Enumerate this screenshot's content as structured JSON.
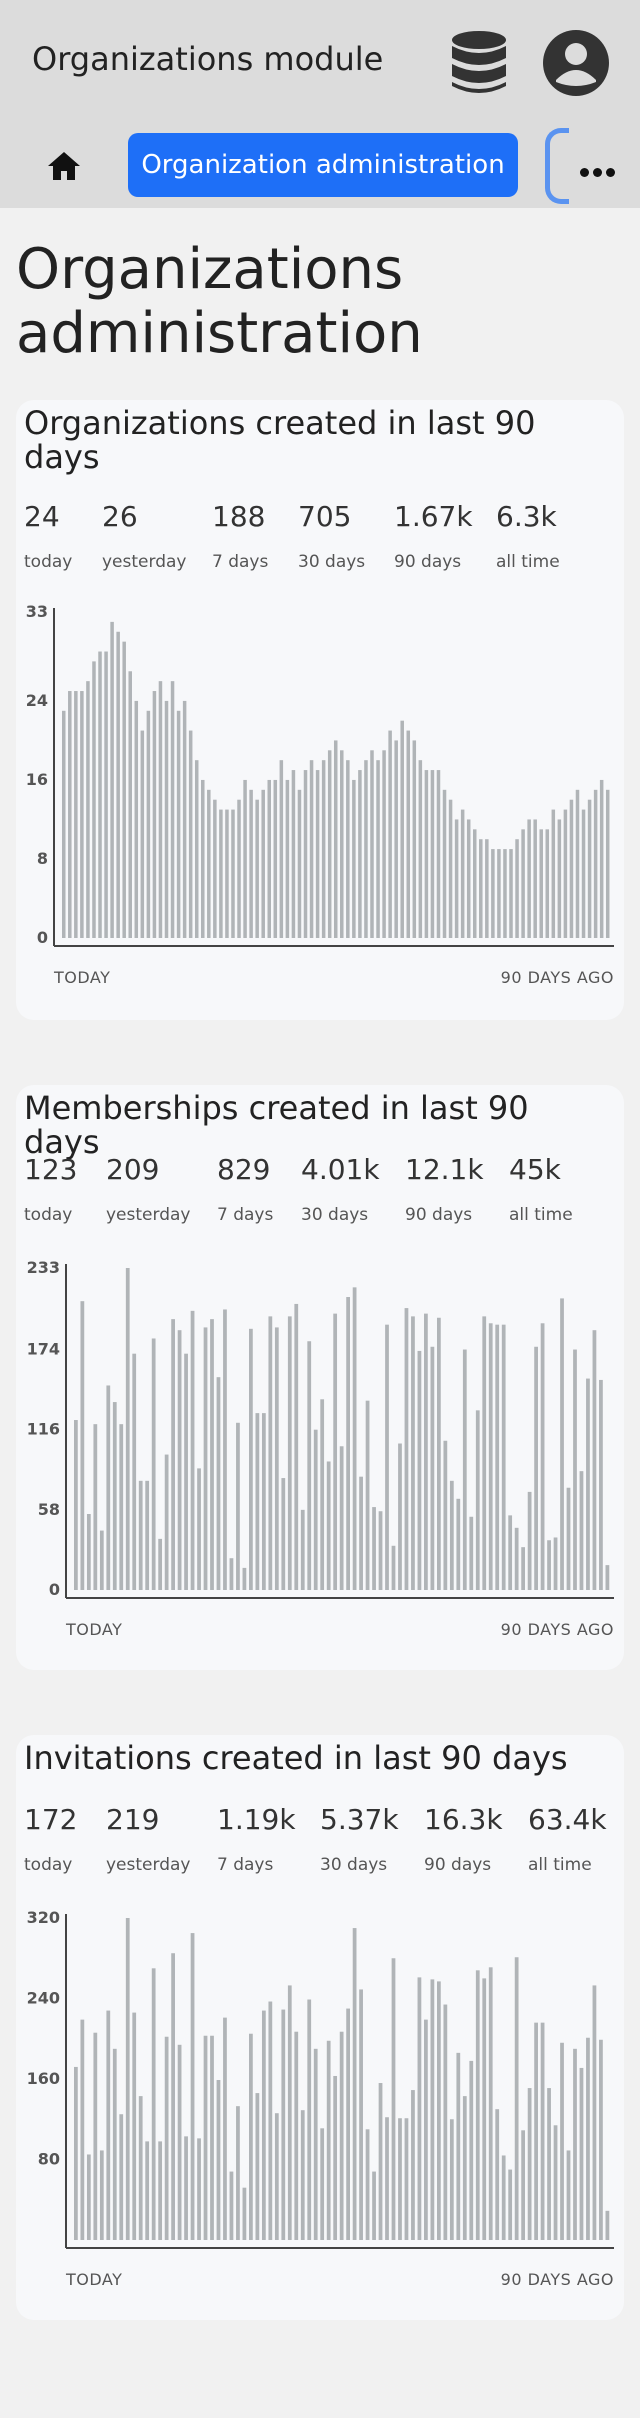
{
  "header": {
    "app_title": "Organizations module",
    "database_icon": "database-icon",
    "user_icon": "user-avatar-icon"
  },
  "nav": {
    "home_icon": "home-icon",
    "active_tab_label": "Organization administration",
    "more_icon": "more-horizontal-icon"
  },
  "page": {
    "title": "Organizations administration"
  },
  "colors": {
    "topbar": "#dcdcdc",
    "accent": "#1e6ff7",
    "bar": "#b0b4b7",
    "card": "#f7f8fa"
  },
  "cards": [
    {
      "title": "Organizations created in last 90 days",
      "stats": [
        {
          "value": "24",
          "label": "today"
        },
        {
          "value": "26",
          "label": "yesterday"
        },
        {
          "value": "188",
          "label": "7 days"
        },
        {
          "value": "705",
          "label": "30 days"
        },
        {
          "value": "1.67k",
          "label": "90 days"
        },
        {
          "value": "6.3k",
          "label": "all time"
        }
      ],
      "x_start_label": "TODAY",
      "x_end_label": "90 DAYS AGO"
    },
    {
      "title": "Memberships created in last 90 days",
      "stats": [
        {
          "value": "123",
          "label": "today"
        },
        {
          "value": "209",
          "label": "yesterday"
        },
        {
          "value": "829",
          "label": "7 days"
        },
        {
          "value": "4.01k",
          "label": "30 days"
        },
        {
          "value": "12.1k",
          "label": "90 days"
        },
        {
          "value": "45k",
          "label": "all time"
        }
      ],
      "x_start_label": "TODAY",
      "x_end_label": "90 DAYS AGO"
    },
    {
      "title": "Invitations created in last 90 days",
      "stats": [
        {
          "value": "172",
          "label": "today"
        },
        {
          "value": "219",
          "label": "yesterday"
        },
        {
          "value": "1.19k",
          "label": "7 days"
        },
        {
          "value": "5.37k",
          "label": "30 days"
        },
        {
          "value": "16.3k",
          "label": "90 days"
        },
        {
          "value": "63.4k",
          "label": "all time"
        }
      ],
      "x_start_label": "TODAY",
      "x_end_label": "90 DAYS AGO"
    }
  ],
  "chart_data": [
    {
      "type": "bar",
      "yticks": [
        "0",
        "8",
        "16",
        "24",
        "33"
      ],
      "ylim": [
        0,
        33
      ],
      "values": [
        23,
        25,
        25,
        25,
        26,
        28,
        29,
        29,
        32,
        31,
        30,
        27,
        24,
        21,
        23,
        25,
        26,
        24,
        26,
        23,
        24,
        21,
        18,
        16,
        15,
        14,
        13,
        13,
        13,
        14,
        16,
        15,
        14,
        15,
        16,
        16,
        18,
        16,
        17,
        15,
        17,
        18,
        17,
        18,
        19,
        20,
        19,
        18,
        16,
        17,
        18,
        19,
        18,
        19,
        21,
        20,
        22,
        21,
        20,
        18,
        17,
        17,
        17,
        15,
        14,
        12,
        13,
        12,
        11,
        10,
        10,
        9,
        9,
        9,
        9,
        10,
        11,
        12,
        12,
        11,
        11,
        13,
        12,
        13,
        14,
        15,
        13,
        14,
        15,
        16,
        15
      ]
    },
    {
      "type": "bar",
      "yticks": [
        "0",
        "58",
        "116",
        "174",
        "233"
      ],
      "ylim": [
        0,
        233
      ],
      "values": [
        123,
        209,
        55,
        120,
        43,
        148,
        136,
        120,
        233,
        171,
        79,
        79,
        182,
        37,
        98,
        196,
        188,
        171,
        202,
        88,
        190,
        196,
        154,
        203,
        23,
        121,
        16,
        189,
        128,
        128,
        198,
        190,
        81,
        198,
        207,
        58,
        180,
        116,
        138,
        93,
        200,
        104,
        212,
        219,
        82,
        137,
        60,
        57,
        192,
        32,
        106,
        204,
        198,
        173,
        200,
        176,
        197,
        108,
        79,
        66,
        174,
        53,
        130,
        198,
        193,
        192,
        192,
        54,
        45,
        31,
        71,
        176,
        193,
        36,
        38,
        211,
        74,
        174,
        86,
        153,
        188,
        152,
        18
      ]
    },
    {
      "type": "bar",
      "yticks": [
        "80",
        "160",
        "240",
        "320"
      ],
      "ylim": [
        0,
        320
      ],
      "values": [
        172,
        219,
        85,
        206,
        89,
        228,
        190,
        125,
        320,
        226,
        143,
        98,
        270,
        98,
        202,
        285,
        194,
        103,
        305,
        101,
        203,
        203,
        159,
        221,
        68,
        133,
        52,
        205,
        146,
        228,
        237,
        126,
        229,
        253,
        207,
        129,
        239,
        190,
        111,
        198,
        163,
        207,
        230,
        310,
        249,
        110,
        68,
        156,
        122,
        280,
        121,
        121,
        149,
        261,
        219,
        259,
        257,
        234,
        120,
        186,
        143,
        178,
        268,
        260,
        271,
        130,
        84,
        70,
        281,
        109,
        151,
        216,
        216,
        151,
        114,
        196,
        89,
        190,
        171,
        201,
        253,
        199,
        29
      ]
    }
  ]
}
